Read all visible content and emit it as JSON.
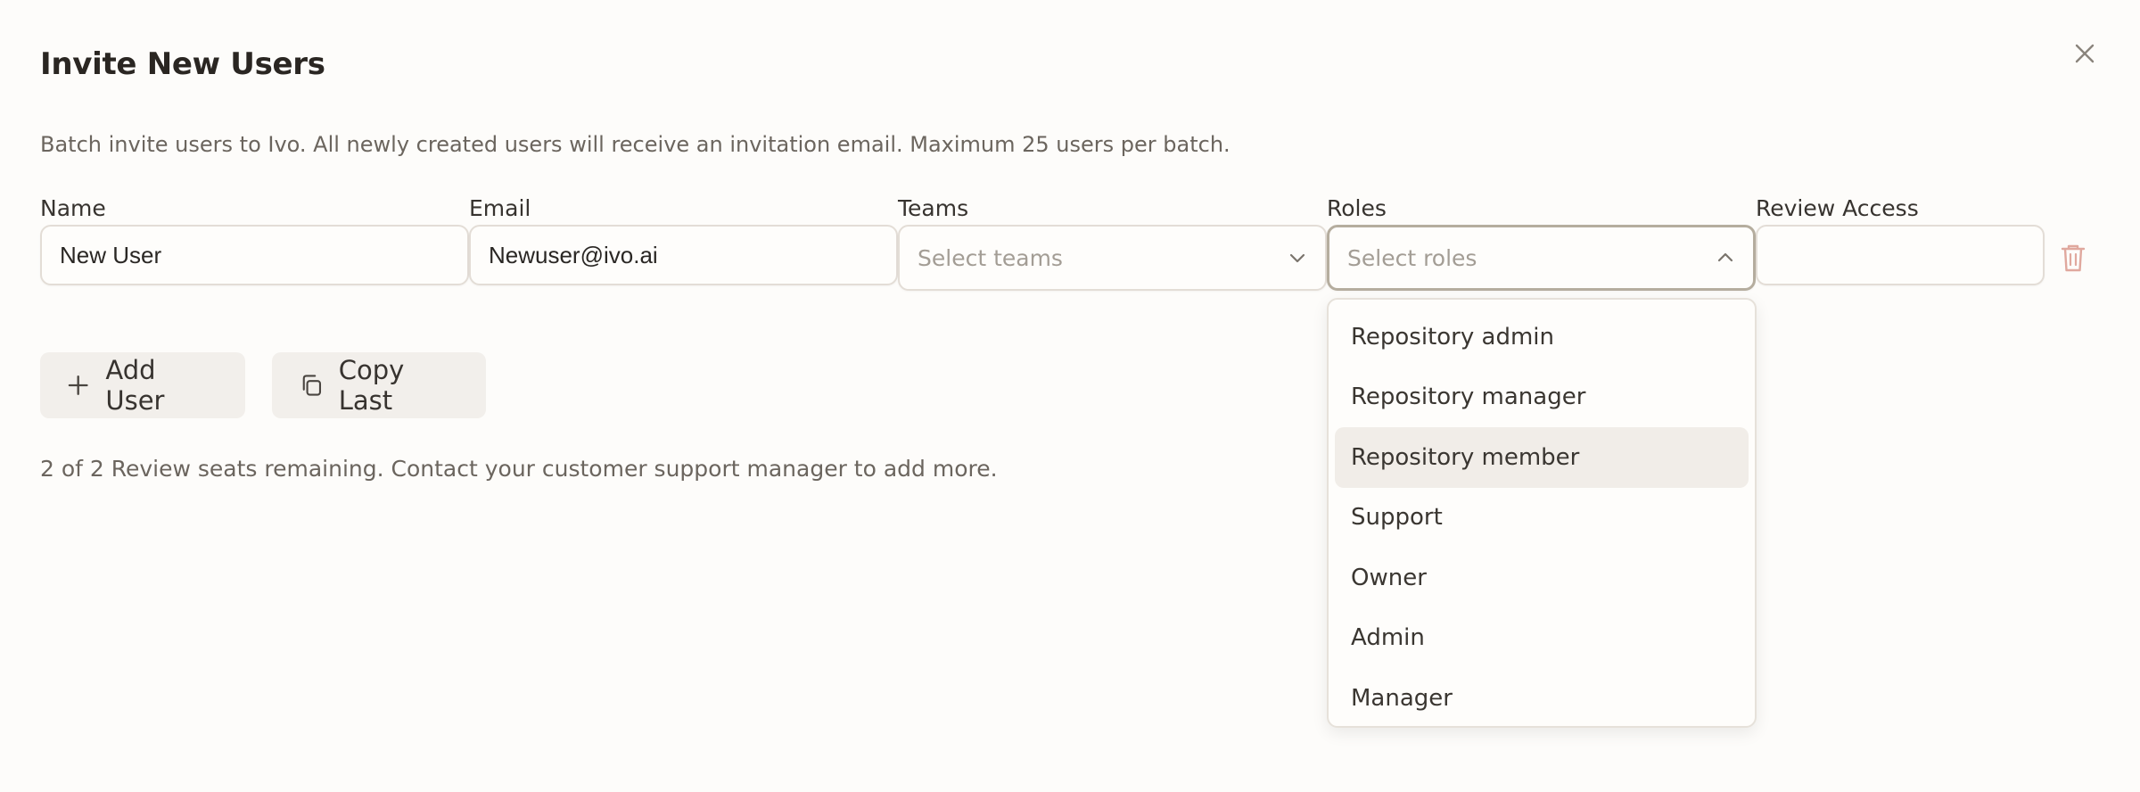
{
  "dialog": {
    "title": "Invite New Users",
    "description": "Batch invite users to Ivo. All newly created users will receive an invitation email. Maximum 25 users per batch."
  },
  "form": {
    "labels": {
      "name": "Name",
      "email": "Email",
      "teams": "Teams",
      "roles": "Roles",
      "review_access": "Review Access"
    },
    "row": {
      "name_value": "New User",
      "email_value": "Newuser@ivo.ai",
      "teams_placeholder": "Select teams",
      "roles_placeholder": "Select roles",
      "review_access_value": ""
    }
  },
  "actions": {
    "add_user": "Add User",
    "copy_last": "Copy Last"
  },
  "seats_text": "2 of 2 Review seats remaining. Contact your customer support manager to add more.",
  "roles_dropdown": {
    "options": [
      "Repository admin",
      "Repository manager",
      "Repository member",
      "Support",
      "Owner",
      "Admin",
      "Manager"
    ],
    "highlighted": "Repository member"
  },
  "icons": {
    "close": "close-icon",
    "teams_chevron": "chevron-down-icon",
    "roles_chevron": "chevron-up-icon",
    "delete": "trash-icon",
    "add": "plus-icon",
    "copy": "copy-icon"
  },
  "colors": {
    "background": "#fdfcfa",
    "delete_icon": "#e0a89e",
    "option_highlight": "#f1ede8"
  }
}
